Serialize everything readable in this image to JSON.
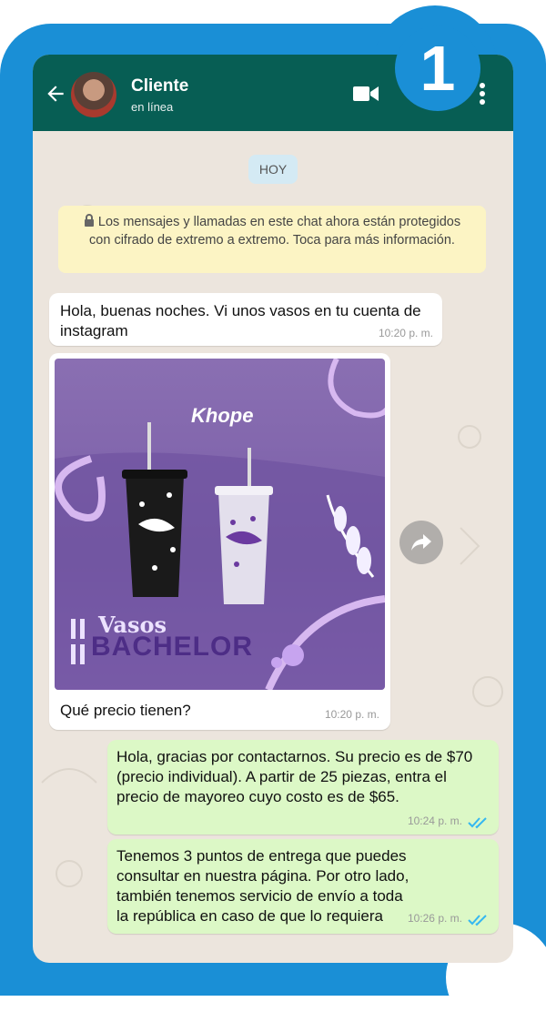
{
  "step_number": "1",
  "header": {
    "contact_name": "Cliente",
    "status": "en línea"
  },
  "chat": {
    "date_chip": "HOY",
    "encryption_notice": "Los mensajes y llamadas en este chat ahora están protegidos con cifrado de extremo a extremo. Toca para más información.",
    "messages": [
      {
        "direction": "in",
        "text": "Hola, buenas noches. Vi unos vasos en tu cuenta de instagram",
        "time": "10:20 p. m."
      },
      {
        "direction": "in",
        "type": "image",
        "caption": "Qué precio tienen?",
        "time": "10:20 p. m.",
        "image": {
          "brand": "Khope",
          "line1": "Vasos",
          "line2": "BACHELOR"
        }
      },
      {
        "direction": "out",
        "text": "Hola, gracias por contactarnos. Su precio es de $70 (precio individual). A partir de 25 piezas, entra el precio de mayoreo cuyo costo es de $65.",
        "time": "10:24 p. m.",
        "status": "read"
      },
      {
        "direction": "out",
        "text": "Tenemos 3 puntos de entrega que puedes consultar en nuestra página. Por otro lado, también tenemos servicio de envío a toda la república en caso de que lo requiera",
        "time": "10:26 p. m.",
        "status": "read"
      }
    ]
  },
  "colors": {
    "frame": "#1a8fd6",
    "header": "#075e54",
    "outgoing_bubble": "#dcf8c6",
    "incoming_bubble": "#ffffff",
    "read_ticks": "#34b7f1",
    "notice": "#fcf4c4"
  },
  "icons": [
    "back-arrow-icon",
    "video-call-icon",
    "more-vert-icon",
    "lock-icon",
    "forward-icon",
    "double-check-icon"
  ]
}
